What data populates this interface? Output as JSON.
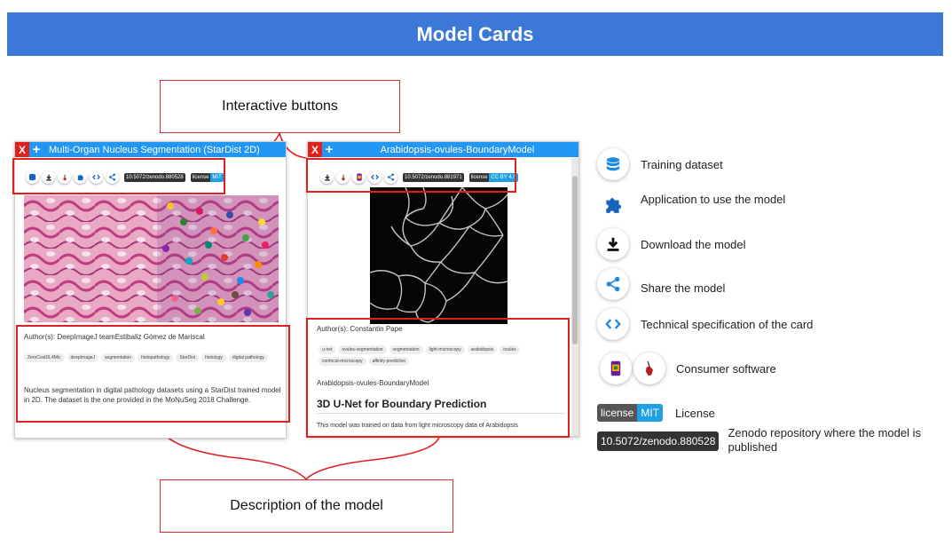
{
  "banner": {
    "title": "Model Cards"
  },
  "callouts": {
    "interactive": "Interactive buttons",
    "description": "Description of the model"
  },
  "card1": {
    "close_label": "X",
    "add_label": "+",
    "title": "Multi-Organ Nucleus Segmentation (StarDist 2D)",
    "doi": "10.5072/zenodo.880528",
    "license_key": "license",
    "license_value": "MIT",
    "authors": "Author(s): DeepImageJ teamEstibaliz Gómez de Mariscal",
    "tags": [
      "ZeroCostDL4Mic",
      "deepImageJ",
      "segmentation",
      "histopathology",
      "StarDist",
      "histology",
      "digital pathology"
    ],
    "description": "Nucleus segmentation in digital pathology datasets using a StarDist trained model in 2D. The dataset is the one provided in the MoNuSeg 2018 Challenge."
  },
  "card2": {
    "close_label": "X",
    "add_label": "+",
    "title": "Arabidopsis-ovules-BoundaryModel",
    "doi": "10.5072/zenodo.881971",
    "license_key": "license",
    "license_value": "CC BY 4.0",
    "authors": "Author(s): Constantin Pape",
    "tags": [
      "u-net",
      "ovules-segmentation",
      "segmentation",
      "light-microscopy",
      "arabidopsis",
      "ovules",
      "confocal-microscopy",
      "affinity-prediction"
    ],
    "name": "Arabidopsis-ovules-BoundaryModel",
    "heading": "3D U-Net for Boundary Prediction",
    "description": "This model was trained on data from light microscopy data of Arabidopsis"
  },
  "legend": {
    "training_dataset": "Training dataset",
    "application": "Application to use the model",
    "download": "Download the model",
    "share": "Share the model",
    "spec": "Technical specification of the card",
    "consumer": "Consumer software",
    "license_key": "license",
    "license_value": "MIT",
    "license_label": "License",
    "doi": "10.5072/zenodo.880528",
    "zenodo_label": "Zenodo repository where the model is published"
  },
  "colors": {
    "banner": "#3c78d8",
    "accent": "#2196f3",
    "close": "#e0201a",
    "highlight": "#e02020"
  }
}
